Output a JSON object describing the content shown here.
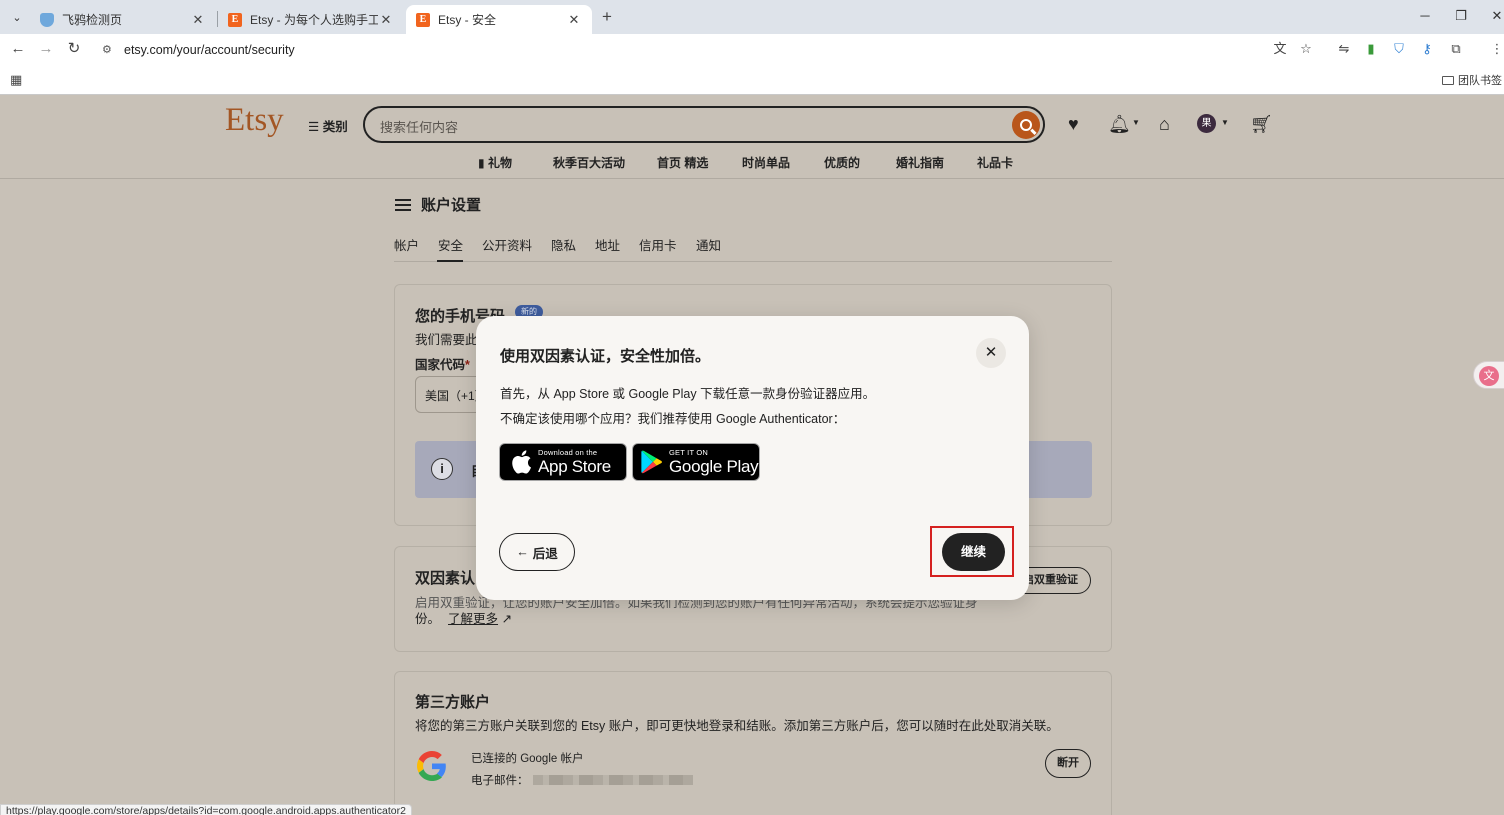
{
  "browser": {
    "tabs": [
      {
        "title": "飞鸦检测页"
      },
      {
        "title": "Etsy - 为每个人选购手工制作..."
      },
      {
        "title": "Etsy - 安全"
      }
    ],
    "url": "etsy.com/your/account/security",
    "bookmark_folder": "团队书签",
    "status_url": "https://play.google.com/store/apps/details?id=com.google.android.apps.authenticator2"
  },
  "header": {
    "logo": "Etsy",
    "categories": "类别",
    "search_placeholder": "搜索任何内容",
    "avatar_initial": "果",
    "subnav": [
      "礼物",
      "秋季百大活动",
      "首页 精选",
      "时尚单品",
      "优质的",
      "婚礼指南",
      "礼品卡"
    ]
  },
  "account": {
    "title": "账户设置",
    "tabs": [
      "帐户",
      "安全",
      "公开资料",
      "隐私",
      "地址",
      "信用卡",
      "通知"
    ]
  },
  "phone_card": {
    "title": "您的手机号码",
    "badge": "新的",
    "desc": "我们需要此",
    "country_label": "国家代码",
    "country_value": "美国（+1）",
    "info_initial": "目"
  },
  "twofa_card": {
    "title": "双因素认",
    "desc_line1": "启用双重验证，让您的账户安全加倍。如果我们检测到您的账户有任何异常活动，系统会提示您验证身",
    "desc_line2": "份。",
    "learn_more": "了解更多",
    "enable_btn": "启双重验证"
  },
  "third_party_card": {
    "title": "第三方账户",
    "desc": "将您的第三方账户关联到您的 Etsy 账户，即可更快地登录和结账。添加第三方账户后，您可以随时在此处取消关联。",
    "connected": "已连接的 Google 帐户",
    "email_label": "电子邮件：",
    "disconnect": "断开"
  },
  "modal": {
    "title": "使用双因素认证，安全性加倍。",
    "p1": "首先，从 App Store 或 Google Play 下载任意一款身份验证器应用。",
    "p2": "不确定该使用哪个应用？我们推荐使用 Google Authenticator：",
    "appstore_small": "Download on the",
    "appstore_big": "App Store",
    "gplay_small": "GET IT ON",
    "gplay_big": "Google Play",
    "back": "后退",
    "continue": "继续"
  }
}
